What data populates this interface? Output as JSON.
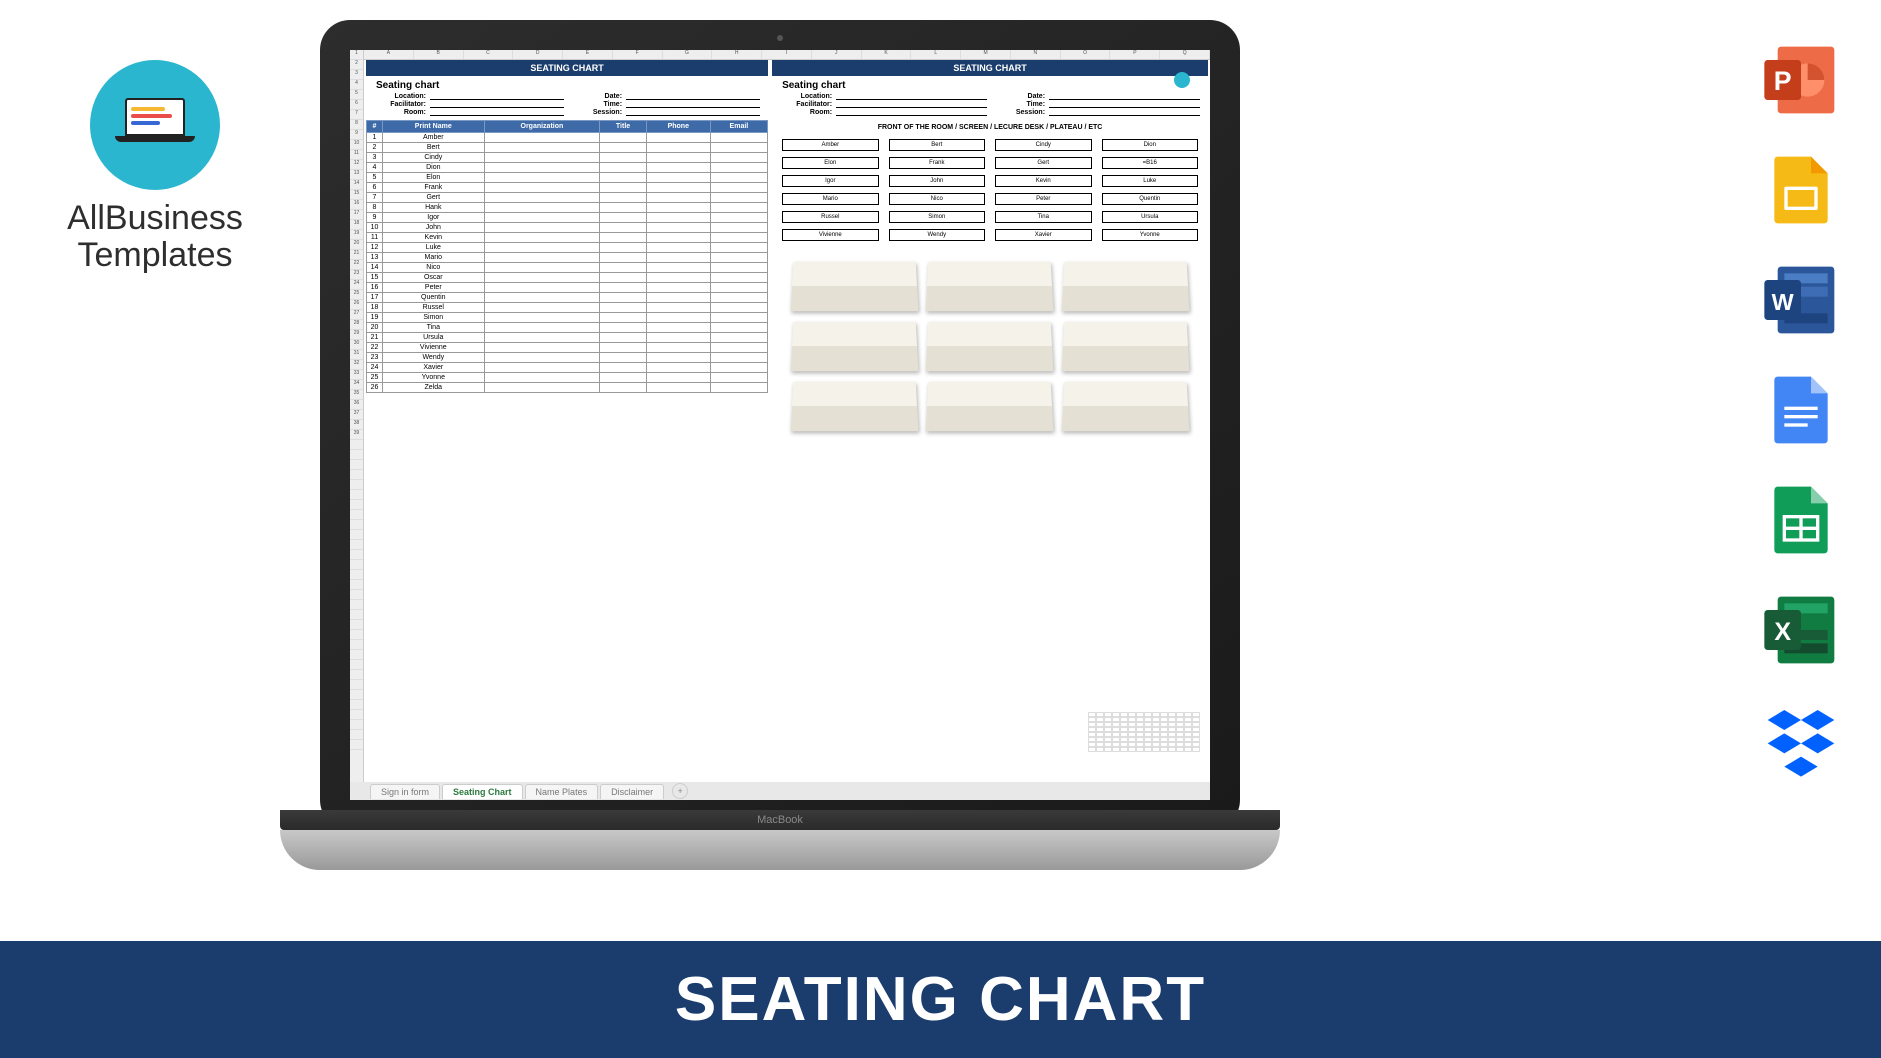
{
  "brand": {
    "line1": "AllBusiness",
    "line2": "Templates"
  },
  "banner": "SEATING CHART",
  "macbook": "MacBook",
  "spreadsheet": {
    "columns": [
      "A",
      "B",
      "C",
      "D",
      "E",
      "F",
      "G",
      "H",
      "I",
      "J",
      "K",
      "L",
      "M",
      "N",
      "O",
      "P",
      "Q"
    ],
    "titleLeft": "SEATING CHART",
    "titleRight": "SEATING CHART",
    "subLeft": "Seating chart",
    "subRight": "Seating chart",
    "metaLabels": {
      "location": "Location:",
      "facilitator": "Facilitator:",
      "room": "Room:",
      "date": "Date:",
      "time": "Time:",
      "session": "Session:"
    },
    "tableHeaders": [
      "#",
      "Print Name",
      "Organization",
      "Title",
      "Phone",
      "Email"
    ],
    "names": [
      "Amber",
      "Bert",
      "Cindy",
      "Dion",
      "Elon",
      "Frank",
      "Gert",
      "Hank",
      "Igor",
      "John",
      "Kevin",
      "Luke",
      "Mario",
      "Nico",
      "Oscar",
      "Peter",
      "Quentin",
      "Russel",
      "Simon",
      "Tina",
      "Ursula",
      "Vivienne",
      "Wendy",
      "Xavier",
      "Yvonne",
      "Zelda"
    ],
    "frontLabel": "FRONT OF THE ROOM / SCREEN / LECURE DESK / PLATEAU / ETC",
    "seats": [
      [
        "Amber",
        "Bert",
        "Cindy",
        "Dion"
      ],
      [
        "Elon",
        "Frank",
        "Gert",
        "=B16"
      ],
      [
        "Igor",
        "John",
        "Kevin",
        "Luke"
      ],
      [
        "Mario",
        "Nico",
        "Peter",
        "Quentin"
      ],
      [
        "Russel",
        "Simon",
        "Tina",
        "Ursula"
      ],
      [
        "Vivienne",
        "Wendy",
        "Xavier",
        "Yvonne"
      ]
    ],
    "tabs": [
      "Sign in form",
      "Seating Chart",
      "Name Plates",
      "Disclaimer"
    ],
    "activeTab": 1,
    "addTab": "+"
  },
  "appIcons": [
    "powerpoint",
    "google-slides",
    "word",
    "google-docs",
    "google-sheets",
    "excel",
    "dropbox"
  ]
}
